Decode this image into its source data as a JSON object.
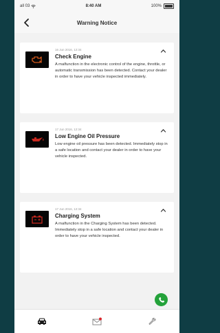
{
  "status_bar": {
    "carrier": "all 03",
    "time": "8:40 AM",
    "battery": "100%",
    "icons": [
      "wifi-icon",
      "battery-icon"
    ]
  },
  "header": {
    "title": "Warning Notice",
    "back_icon": "chevron-left-icon"
  },
  "notices": [
    {
      "time": "16 Jun 2016, 12:34",
      "title": "Check Engine",
      "description": "A malfunction in the electronic control of the engine, throttle, or automatic transmission has been detected. Contact your dealer in order to have your vehicle inspected immediately.",
      "icon": "check-engine-icon",
      "icon_color": "#d45a1d"
    },
    {
      "time": "17 Jun 2016, 12:34",
      "title": "Low Engine Oil Pressure",
      "description": "Low engine oil pressure has been detected. Immediately stop in a safe location and contact your dealer in order to have your vehicle inspected.",
      "icon": "oil-can-icon",
      "icon_color": "#c8281f"
    },
    {
      "time": "17 Jun 2016, 12:34",
      "title": "Charging System",
      "description": "A malfunction in the Charging System has been detected. Immediately stop in a safe location and contact your dealer in order to have your vehicle inspected.",
      "icon": "battery-warning-icon",
      "icon_color": "#c8281f"
    }
  ],
  "fab": {
    "icon": "phone-icon",
    "color": "#24a23a"
  },
  "tabbar": {
    "tabs": [
      {
        "icon": "car-icon"
      },
      {
        "icon": "mail-icon",
        "badge_color": "#d9252b"
      },
      {
        "icon": "wrench-icon"
      }
    ]
  }
}
